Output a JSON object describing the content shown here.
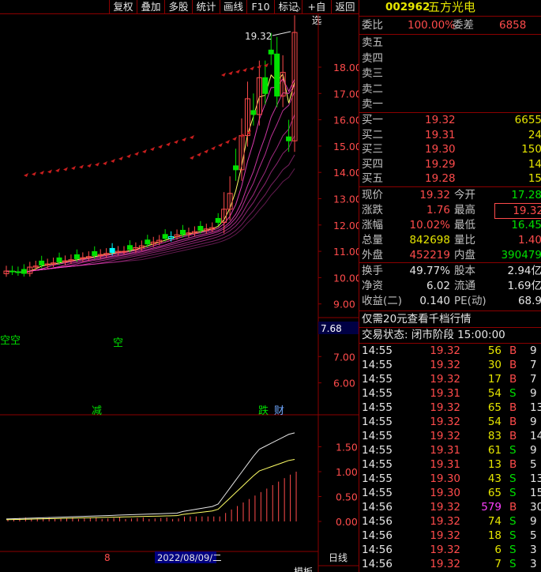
{
  "toolbar": {
    "buttons": [
      "复权",
      "叠加",
      "多股",
      "统计",
      "画线",
      "F10",
      "标记",
      "+自选",
      "返回"
    ]
  },
  "chart": {
    "high_label": "19.32",
    "price_axis": [
      "18.00",
      "17.00",
      "16.00",
      "15.00",
      "14.00",
      "13.00",
      "12.00",
      "11.00",
      "10.00",
      "9.00",
      "8.00",
      "7.00",
      "6.00"
    ],
    "current_marker": "7.68",
    "indicator_axis": [
      "1.50",
      "1.00",
      "0.50",
      "0.00"
    ],
    "signals": {
      "kong1": "空空",
      "kong2": "空",
      "jian": "减",
      "die": "跌",
      "cai": "财"
    },
    "date_label": "2022/08/09/二",
    "month_label": "8",
    "period_label": "日线",
    "bottom_tab": "模板"
  },
  "quote": {
    "code": "002962",
    "name": "五方光电",
    "weibi_label": "委比",
    "weibi_value": "100.00%",
    "weicha_label": "委差",
    "weicha_value": "6858",
    "sell": [
      {
        "label": "卖五"
      },
      {
        "label": "卖四"
      },
      {
        "label": "卖三"
      },
      {
        "label": "卖二"
      },
      {
        "label": "卖一"
      }
    ],
    "buy": [
      {
        "label": "买一",
        "price": "19.32",
        "vol": "6655"
      },
      {
        "label": "买二",
        "price": "19.31",
        "vol": "24"
      },
      {
        "label": "买三",
        "price": "19.30",
        "vol": "150"
      },
      {
        "label": "买四",
        "price": "19.29",
        "vol": "14"
      },
      {
        "label": "买五",
        "price": "19.28",
        "vol": "15"
      }
    ],
    "stats": [
      {
        "l1": "现价",
        "v1": "19.32",
        "l2": "今开",
        "v2": "17.28"
      },
      {
        "l1": "涨跌",
        "v1": "1.76",
        "l2": "最高",
        "v2": "19.32"
      },
      {
        "l1": "涨幅",
        "v1": "10.02%",
        "l2": "最低",
        "v2": "16.45"
      },
      {
        "l1": "总量",
        "v1": "842698",
        "l2": "量比",
        "v2": "1.40"
      },
      {
        "l1": "外盘",
        "v1": "452219",
        "l2": "内盘",
        "v2": "390479"
      }
    ],
    "fund": [
      {
        "l1": "换手",
        "v1": "49.77%",
        "l2": "股本",
        "v2": "2.94亿"
      },
      {
        "l1": "净资",
        "v1": "6.02",
        "l2": "流通",
        "v2": "1.69亿"
      },
      {
        "l1": "收益(二)",
        "v1": "0.140",
        "l2": "PE(动)",
        "v2": "68.9"
      }
    ],
    "promo": "仅需20元查看千档行情",
    "status": "交易状态: 闭市阶段 15:00:00"
  },
  "ticks": [
    {
      "t": "14:55",
      "p": "19.32",
      "v": "56",
      "bs": "B",
      "n": "9"
    },
    {
      "t": "14:55",
      "p": "19.32",
      "v": "30",
      "bs": "B",
      "n": "7"
    },
    {
      "t": "14:55",
      "p": "19.32",
      "v": "17",
      "bs": "B",
      "n": "7"
    },
    {
      "t": "14:55",
      "p": "19.31",
      "v": "54",
      "bs": "S",
      "n": "9"
    },
    {
      "t": "14:55",
      "p": "19.32",
      "v": "65",
      "bs": "B",
      "n": "13"
    },
    {
      "t": "14:55",
      "p": "19.32",
      "v": "54",
      "bs": "B",
      "n": "9"
    },
    {
      "t": "14:55",
      "p": "19.32",
      "v": "83",
      "bs": "B",
      "n": "14"
    },
    {
      "t": "14:55",
      "p": "19.31",
      "v": "61",
      "bs": "S",
      "n": "9"
    },
    {
      "t": "14:55",
      "p": "19.31",
      "v": "13",
      "bs": "B",
      "n": "5"
    },
    {
      "t": "14:55",
      "p": "19.30",
      "v": "43",
      "bs": "S",
      "n": "13"
    },
    {
      "t": "14:55",
      "p": "19.30",
      "v": "65",
      "bs": "S",
      "n": "15"
    },
    {
      "t": "14:56",
      "p": "19.32",
      "v": "579",
      "bs": "B",
      "n": "30"
    },
    {
      "t": "14:56",
      "p": "19.32",
      "v": "74",
      "bs": "S",
      "n": "9"
    },
    {
      "t": "14:56",
      "p": "19.32",
      "v": "18",
      "bs": "S",
      "n": "5"
    },
    {
      "t": "14:56",
      "p": "19.32",
      "v": "6",
      "bs": "S",
      "n": "3"
    },
    {
      "t": "14:56",
      "p": "19.32",
      "v": "7",
      "bs": "S",
      "n": "3"
    }
  ],
  "colors": {
    "up": "#ff4b4b",
    "down": "#00e000",
    "frame": "#8b0000",
    "code": "#e6e600",
    "ma_yellow": "#ffff66",
    "ma_pink": "#ff44cc",
    "cyan": "#00ffff"
  }
}
